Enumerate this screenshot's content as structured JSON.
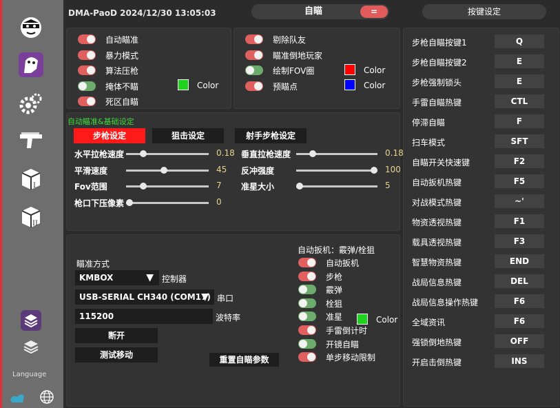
{
  "window": {
    "title": "DMA-PaoD 2024/12/30 13:05:03"
  },
  "top_tab": {
    "label": "自瞄",
    "menu_icon": "="
  },
  "hotkey_panel_title": "按键设定",
  "sidebar": {
    "language_label": "Language"
  },
  "aim_toggles": [
    {
      "label": "自动瞄准",
      "on": true
    },
    {
      "label": "暴力模式",
      "on": true
    },
    {
      "label": "算法压枪",
      "on": true
    },
    {
      "label": "掩体不瞄",
      "on": false
    },
    {
      "label": "死区自瞄",
      "on": true
    }
  ],
  "aim_color": {
    "label": "Color",
    "color": "#1ed21e"
  },
  "filter_toggles": [
    {
      "label": "剔除队友",
      "on": true
    },
    {
      "label": "瞄准倒地玩家",
      "on": true
    },
    {
      "label": "绘制FOV圈",
      "on": false
    },
    {
      "label": "预瞄点",
      "on": true
    }
  ],
  "fov_color": {
    "label": "Color",
    "color": "#ff0000"
  },
  "pre_color": {
    "label": "Color",
    "color": "#0000ff"
  },
  "basic": {
    "section_title": "自动瞄准&基础设定",
    "tabs": [
      "步枪设定",
      "狙击设定",
      "射手步枪设定"
    ],
    "active_tab": 0,
    "sliders_left": [
      {
        "label": "水平拉枪速度",
        "value": "0.18",
        "fraction": 0.18
      },
      {
        "label": "平滑速度",
        "value": "45",
        "fraction": 0.45
      },
      {
        "label": "Fov范围",
        "value": "7",
        "fraction": 0.18
      },
      {
        "label": "枪口下压像素",
        "value": "0",
        "fraction": 0.0
      }
    ],
    "sliders_right": [
      {
        "label": "垂直拉枪速度",
        "value": "0.18",
        "fraction": 0.18
      },
      {
        "label": "反冲强度",
        "value": "100",
        "fraction": 1.0
      },
      {
        "label": "准星大小",
        "value": "5",
        "fraction": 0.0
      }
    ]
  },
  "device": {
    "aim_method_label": "瞄准方式",
    "controller_select": "KMBOX",
    "controller_label": "控制器",
    "port_select": "USB-SERIAL CH340 (COM17)",
    "port_label": "串口",
    "baud_value": "115200",
    "baud_label": "波特率",
    "disconnect_button": "断开",
    "test_button": "测试移动",
    "reset_button": "重置自瞄参数"
  },
  "auto_trigger": {
    "title": "自动扳机：霰弹/栓狙",
    "items": [
      {
        "label": "自动扳机",
        "on": true
      },
      {
        "label": "步枪",
        "on": true
      },
      {
        "label": "霰弹",
        "on": false
      },
      {
        "label": "栓狙",
        "on": false
      },
      {
        "label": "准星",
        "on": false
      },
      {
        "label": "手雷倒计时",
        "on": true
      },
      {
        "label": "开镜自瞄",
        "on": false
      },
      {
        "label": "单步移动限制",
        "on": true
      }
    ],
    "color": {
      "label": "Color",
      "color": "#1ed21e"
    }
  },
  "hotkeys": [
    {
      "label": "步枪自瞄按键1",
      "key": "Q"
    },
    {
      "label": "步枪自瞄按键2",
      "key": "E"
    },
    {
      "label": "步枪强制锁头",
      "key": "E"
    },
    {
      "label": "手雷自瞄热键",
      "key": "CTL"
    },
    {
      "label": "停滞自瞄",
      "key": "F"
    },
    {
      "label": "扫车模式",
      "key": "SFT"
    },
    {
      "label": "自瞄开关快速键",
      "key": "F2"
    },
    {
      "label": "自动扳机热键",
      "key": "F5"
    },
    {
      "label": "对战模式热键",
      "key": "~'"
    },
    {
      "label": "物资透视热键",
      "key": "F1"
    },
    {
      "label": "载具透视热键",
      "key": "F3"
    },
    {
      "label": "智慧物资热键",
      "key": "END"
    },
    {
      "label": "战局信息热键",
      "key": "DEL"
    },
    {
      "label": "战局信息操作热键",
      "key": "F6"
    },
    {
      "label": "全域资讯",
      "key": "F6"
    },
    {
      "label": "强锁倒地热键",
      "key": "OFF"
    },
    {
      "label": "开启击倒热键",
      "key": "INS"
    }
  ]
}
